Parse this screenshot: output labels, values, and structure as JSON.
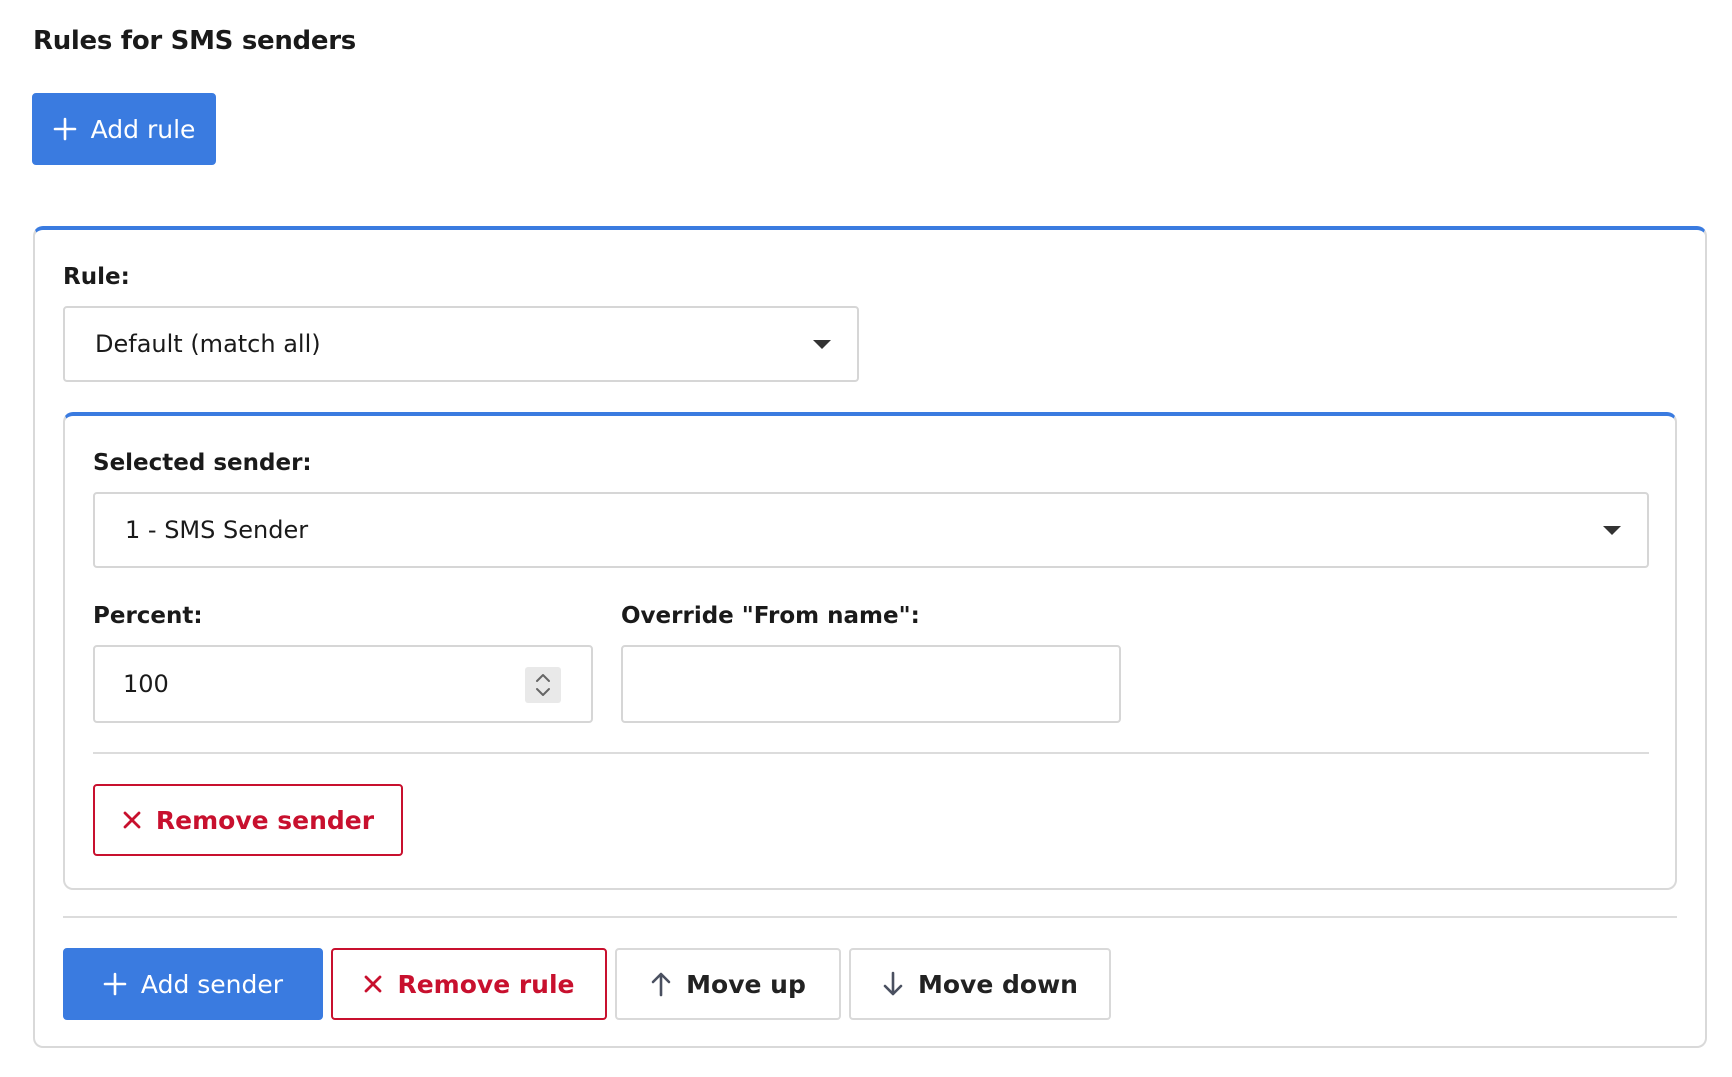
{
  "page": {
    "title": "Rules for SMS senders",
    "add_rule_label": "Add rule"
  },
  "rule": {
    "label": "Rule:",
    "selected": "Default (match all)",
    "sender": {
      "selected_label": "Selected sender:",
      "selected_value": "1 - SMS Sender",
      "percent_label": "Percent:",
      "percent_value": "100",
      "override_label": "Override \"From name\":",
      "override_value": "",
      "remove_sender_label": "Remove sender"
    },
    "actions": {
      "add_sender": "Add sender",
      "remove_rule": "Remove rule",
      "move_up": "Move up",
      "move_down": "Move down"
    }
  },
  "colors": {
    "primary": "#3a7be0",
    "danger": "#c8102e",
    "border": "#d9d9d9"
  },
  "icons": {
    "add": "plus-icon",
    "remove": "close-icon",
    "up": "arrow-up-icon",
    "down": "arrow-down-icon",
    "dropdown": "caret-down-icon",
    "spinner": "chevron-up-down-icon"
  }
}
